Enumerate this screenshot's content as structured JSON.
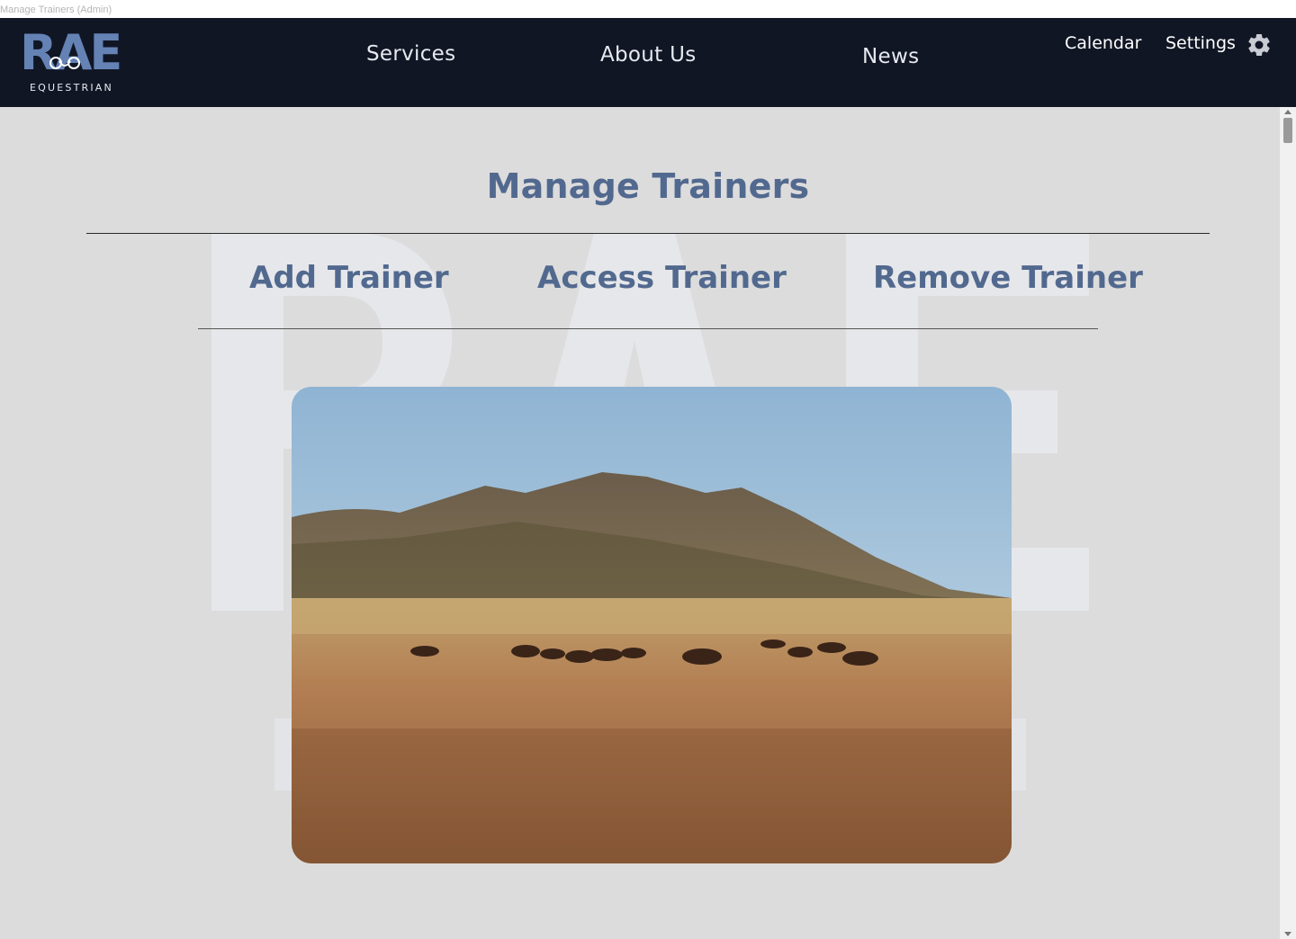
{
  "window": {
    "title": "Manage Trainers (Admin)"
  },
  "header": {
    "logo": {
      "letters": "RAE",
      "subtitle": "EQUESTRIAN"
    },
    "nav": [
      {
        "label": "Services"
      },
      {
        "label": "About Us"
      },
      {
        "label": "News"
      }
    ],
    "right": {
      "calendar_label": "Calendar",
      "settings_label": "Settings",
      "settings_icon": "gear-icon"
    }
  },
  "main": {
    "title": "Manage Trainers",
    "tabs": [
      {
        "label": "Add Trainer"
      },
      {
        "label": "Access Trainer"
      },
      {
        "label": "Remove Trainer"
      }
    ],
    "image": {
      "subject": "wild horses grazing on a prairie below a mountain"
    },
    "watermark_letters": "RAE"
  },
  "colors": {
    "navbar_bg": "#111625",
    "accent": "#52698f",
    "logo_blue": "#6482b4",
    "page_bg": "#dcdcdc"
  }
}
